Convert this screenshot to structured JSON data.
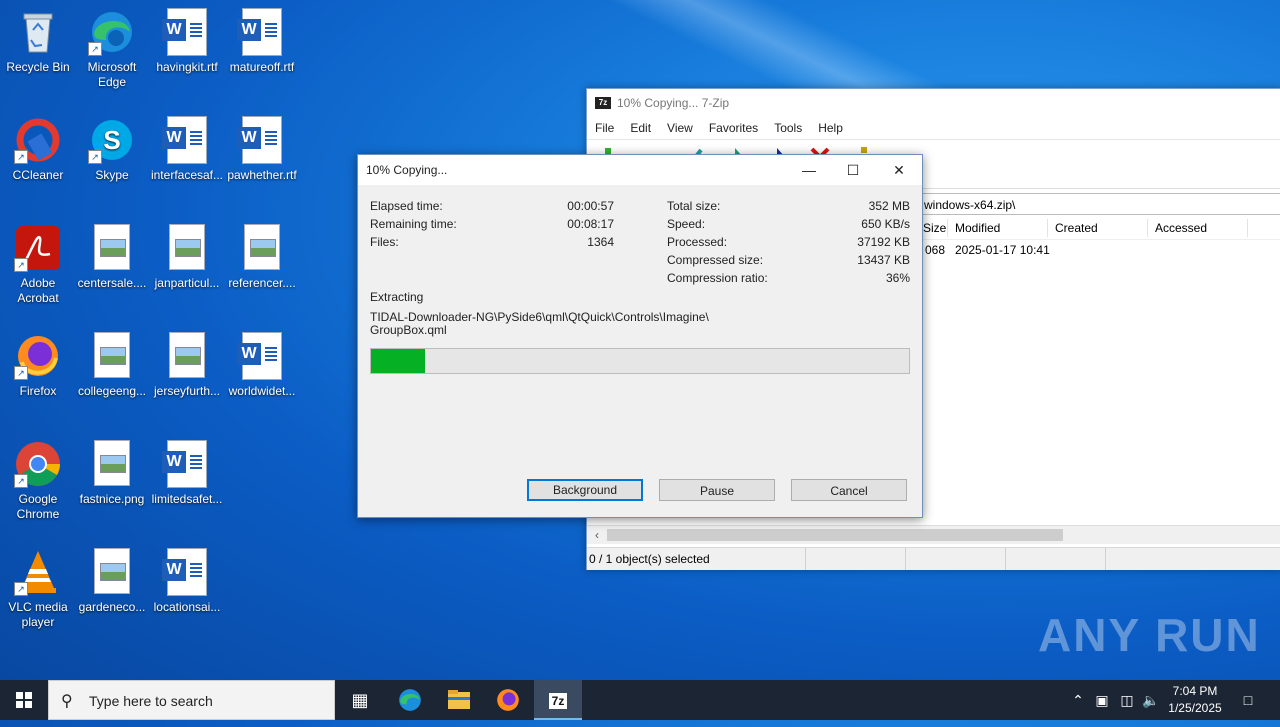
{
  "desktop": {
    "icons": [
      {
        "label": "Recycle Bin"
      },
      {
        "label": "Microsoft Edge"
      },
      {
        "label": "havingkit.rtf"
      },
      {
        "label": "matureoff.rtf"
      },
      {
        "label": "CCleaner"
      },
      {
        "label": "Skype"
      },
      {
        "label": "interfacesaf..."
      },
      {
        "label": "pawhether.rtf"
      },
      {
        "label": "Adobe Acrobat"
      },
      {
        "label": "centersale...."
      },
      {
        "label": "janparticul..."
      },
      {
        "label": "referencer...."
      },
      {
        "label": "Firefox"
      },
      {
        "label": "collegeeng..."
      },
      {
        "label": "jerseyfurth..."
      },
      {
        "label": "worldwidet..."
      },
      {
        "label": "Google Chrome"
      },
      {
        "label": "fastnice.png"
      },
      {
        "label": "limitedsafet..."
      },
      {
        "label": "VLC media player"
      },
      {
        "label": "gardeneco..."
      },
      {
        "label": "locationsai..."
      }
    ]
  },
  "zip_window": {
    "title": "10% Copying... 7-Zip",
    "logo": "7z",
    "menu": [
      "File",
      "Edit",
      "View",
      "Favorites",
      "Tools",
      "Help"
    ],
    "address": "windows-x64.zip\\",
    "columns": [
      "Size",
      "Modified",
      "Created",
      "Accessed"
    ],
    "row": {
      "size": "068",
      "modified": "2025-01-17 10:41"
    },
    "status": "0 / 1 object(s) selected"
  },
  "dialog": {
    "title": "10% Copying...",
    "left_stats": [
      {
        "label": "Elapsed time:",
        "value": "00:00:57"
      },
      {
        "label": "Remaining time:",
        "value": "00:08:17"
      },
      {
        "label": "Files:",
        "value": "1364"
      }
    ],
    "right_stats": [
      {
        "label": "Total size:",
        "value": "352 MB"
      },
      {
        "label": "Speed:",
        "value": "650 KB/s"
      },
      {
        "label": "Processed:",
        "value": "37192 KB"
      },
      {
        "label": "Compressed size:",
        "value": "13437 KB"
      },
      {
        "label": "Compression ratio:",
        "value": "36%"
      }
    ],
    "operation": "Extracting",
    "path_line1": "TIDAL-Downloader-NG\\PySide6\\qml\\QtQuick\\Controls\\Imagine\\",
    "path_line2": "GroupBox.qml",
    "progress_percent": 10,
    "buttons": {
      "background": "Background",
      "pause": "Pause",
      "cancel": "Cancel"
    }
  },
  "watermark": "ANY RUN",
  "taskbar": {
    "search_placeholder": "Type here to search",
    "time": "7:04 PM",
    "date": "1/25/2025",
    "seven_zip_label": "7z"
  },
  "colors": {
    "progress": "#06b025",
    "accent": "#0078d7",
    "taskbar": "#1c2533"
  }
}
